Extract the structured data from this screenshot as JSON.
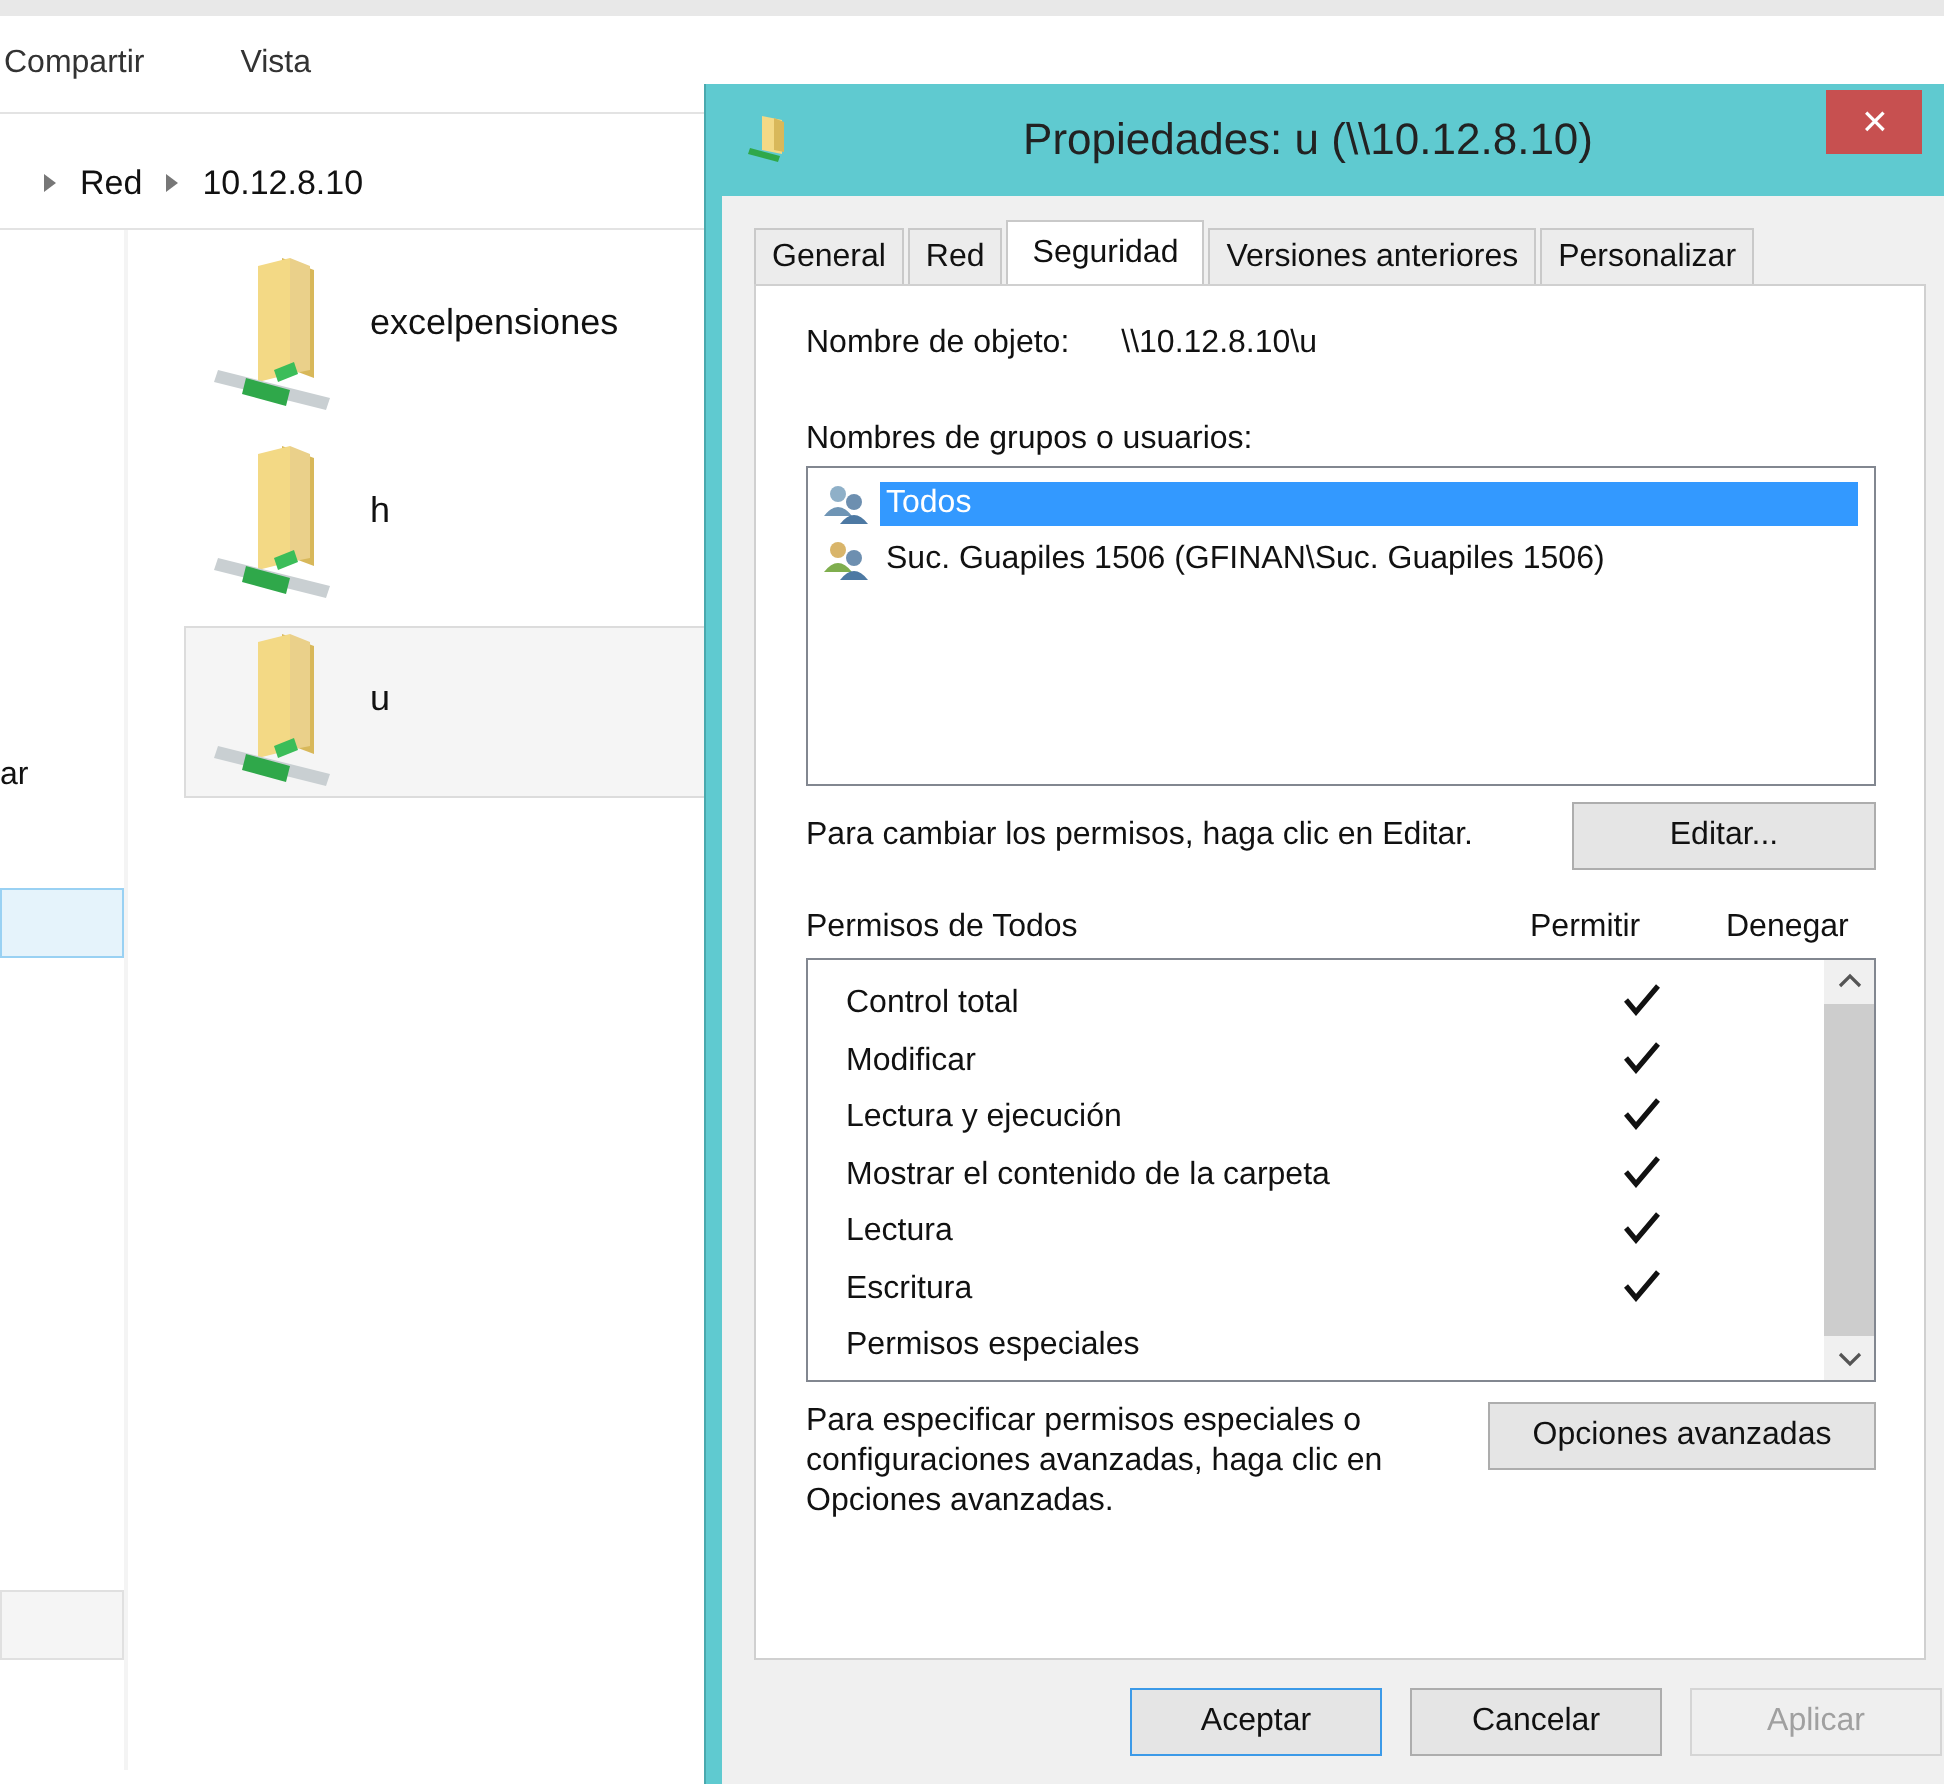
{
  "explorer": {
    "ribbon_tabs": [
      "Compartir",
      "Vista"
    ],
    "breadcrumb": [
      "Red",
      "10.12.8.10"
    ],
    "nav_text": "ar",
    "nav_items": [
      {
        "selected": true
      },
      {
        "selected": false
      }
    ],
    "files": [
      {
        "name": "excelpensiones",
        "selected": false
      },
      {
        "name": "h",
        "selected": false
      },
      {
        "name": "u",
        "selected": true
      }
    ]
  },
  "dialog": {
    "title": "Propiedades: u (\\\\10.12.8.10)",
    "close": "×",
    "tabs": [
      {
        "label": "General",
        "selected": false
      },
      {
        "label": "Red",
        "selected": false
      },
      {
        "label": "Seguridad",
        "selected": true
      },
      {
        "label": "Versiones anteriores",
        "selected": false
      },
      {
        "label": "Personalizar",
        "selected": false
      }
    ],
    "object_name_label": "Nombre de objeto:",
    "object_name_value": "\\\\10.12.8.10\\u",
    "groups_label": "Nombres de grupos o usuarios:",
    "groups": [
      {
        "name": "Todos",
        "selected": true
      },
      {
        "name": "Suc. Guapiles 1506 (GFINAN\\Suc. Guapiles 1506)",
        "selected": false
      }
    ],
    "change_hint": "Para cambiar los permisos, haga clic en Editar.",
    "edit_button": "Editar...",
    "permissions_label": "Permisos de Todos",
    "allow_header": "Permitir",
    "deny_header": "Denegar",
    "permissions": [
      {
        "name": "Control total",
        "allow": true
      },
      {
        "name": "Modificar",
        "allow": true
      },
      {
        "name": "Lectura y ejecución",
        "allow": true
      },
      {
        "name": "Mostrar el contenido de la carpeta",
        "allow": true
      },
      {
        "name": "Lectura",
        "allow": true
      },
      {
        "name": "Escritura",
        "allow": true
      },
      {
        "name": "Permisos especiales",
        "allow": false
      }
    ],
    "advanced_hint": "Para especificar permisos especiales o configuraciones avanzadas, haga clic en Opciones avanzadas.",
    "advanced_button": "Opciones avanzadas",
    "buttons": [
      {
        "label": "Aceptar",
        "default": true,
        "disabled": false
      },
      {
        "label": "Cancelar",
        "default": false,
        "disabled": false
      },
      {
        "label": "Aplicar",
        "default": false,
        "disabled": true
      }
    ]
  }
}
